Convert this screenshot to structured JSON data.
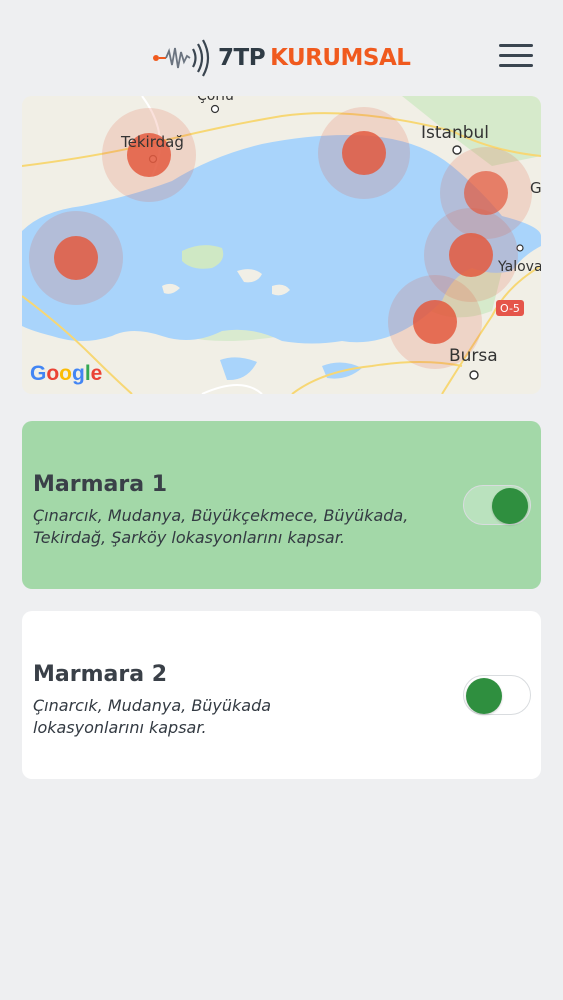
{
  "header": {
    "logo_part1": "7TP",
    "logo_part2": "KURUMSAL"
  },
  "map": {
    "labels": {
      "corlu": "Çorlu",
      "tekirdag": "Tekirdağ",
      "istanbul": "Istanbul",
      "yalova": "Yalova",
      "bursa": "Bursa",
      "road": "O-5",
      "edge_g": "G"
    },
    "attribution": "Google"
  },
  "packages": [
    {
      "title": "Marmara 1",
      "description_line1": "Çınarcık, Mudanya, Büyükçekmece, Büyükada,",
      "description_line2": "Tekirdağ, Şarköy lokasyonlarını kapsar.",
      "enabled": true
    },
    {
      "title": "Marmara 2",
      "description_line1": "Çınarcık, Mudanya, Büyükada",
      "description_line2": "lokasyonlarını kapsar.",
      "enabled": false
    }
  ],
  "colors": {
    "accent": "#f05a1e",
    "selected_card": "#a3d8a8",
    "toggle_knob": "#2f8f3f",
    "sea": "#a9d4fb",
    "marker": "#e35a3f"
  }
}
